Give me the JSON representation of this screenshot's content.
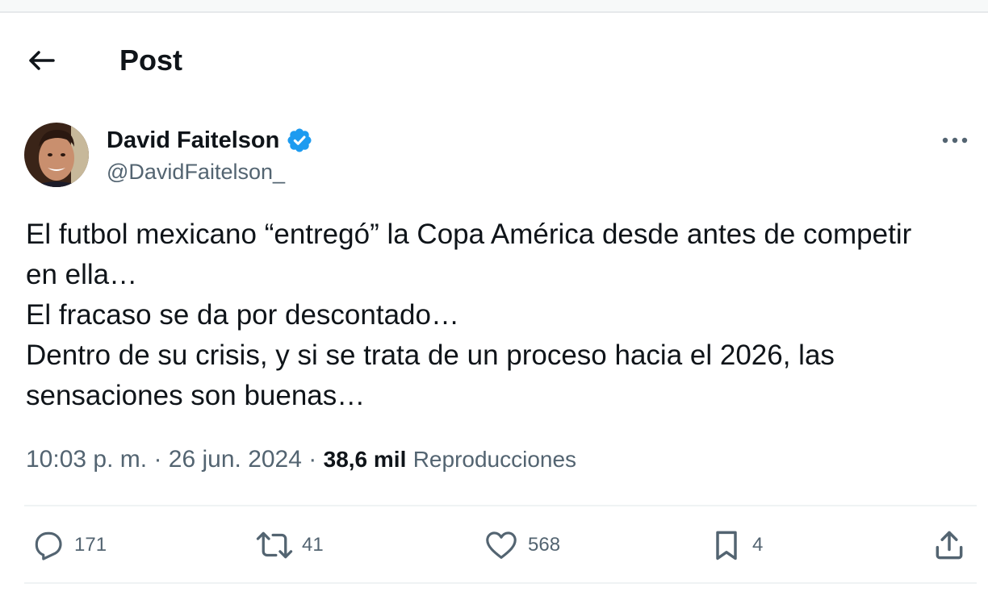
{
  "header": {
    "title": "Post",
    "back_icon": "arrow-left-icon"
  },
  "author": {
    "display_name": "David Faitelson",
    "handle": "@DavidFaitelson_",
    "verified": true,
    "verified_color": "#1d9bf0"
  },
  "post": {
    "lines": [
      "El futbol mexicano “entregó” la Copa América desde antes de competir",
      "en ella…",
      "El fracaso se da por descontado…",
      "Dentro de su crisis, y si se trata de un proceso hacia el 2026, las",
      "sensaciones son buenas…"
    ],
    "time": "10:03 p. m.",
    "separator": "·",
    "date": "26 jun. 2024",
    "views_count": "38,6 mil",
    "views_label": "Reproducciones"
  },
  "actions": {
    "replies": "171",
    "reposts": "41",
    "likes": "568",
    "bookmarks": "4"
  },
  "colors": {
    "text_primary": "#0f1419",
    "text_secondary": "#536471",
    "divider": "#eff3f4"
  }
}
